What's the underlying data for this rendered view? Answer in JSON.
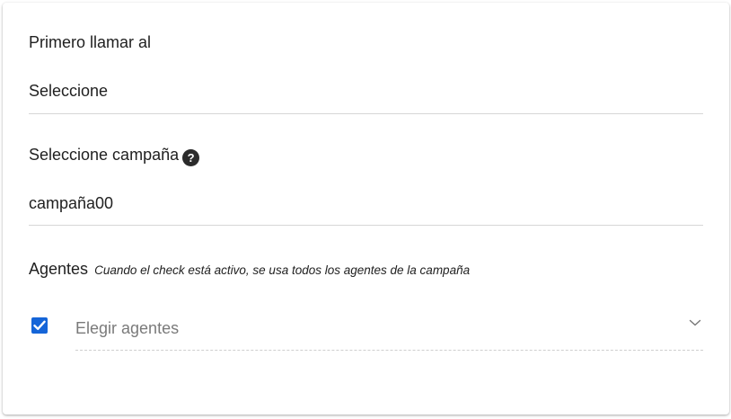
{
  "form": {
    "first_call": {
      "label": "Primero llamar al",
      "value": "Seleccione"
    },
    "campaign": {
      "label": "Seleccione campaña",
      "help_icon": "question-circle-icon",
      "value": "campaña00"
    },
    "agents": {
      "label": "Agentes",
      "hint": "Cuando el check está activo, se usa todos los agentes de la campaña",
      "checkbox_checked": true,
      "select_placeholder": "Elegir agentes",
      "dropdown_icon": "chevron-down-icon"
    }
  },
  "colors": {
    "checkbox": "#1565d8",
    "text": "#212121",
    "placeholder": "#7a7a7a"
  }
}
